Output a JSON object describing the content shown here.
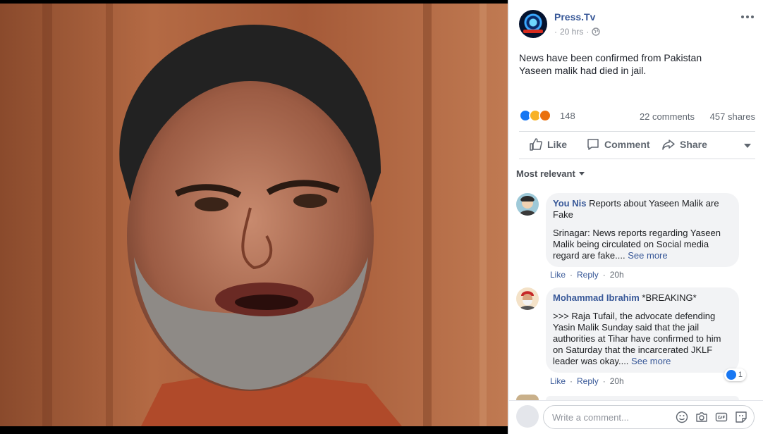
{
  "post": {
    "page_name": "Press.Tv",
    "time": "20 hrs",
    "text_lines": [
      "News have been confirmed from Pakistan",
      "Yaseen malik had died in jail."
    ],
    "reaction_count": "148",
    "comments_count": "22 comments",
    "shares_count": "457 shares"
  },
  "actions": {
    "like": "Like",
    "comment": "Comment",
    "share": "Share"
  },
  "sort_label": "Most relevant",
  "comments": [
    {
      "author": "You Nis",
      "lead": "Reports about Yaseen Malik are Fake",
      "body": "Srinagar: News reports regarding Yaseen Malik being circulated on Social media regard are fake....",
      "see_more": "See more",
      "like": "Like",
      "reply": "Reply",
      "time": "20h"
    },
    {
      "author": "Mohammad Ibrahim",
      "lead": "*BREAKING*",
      "body": ">>> Raja Tufail, the advocate defending Yasin Malik Sunday said that the jail authorities at Tihar have confirmed to him on Saturday that the incarcerated JKLF leader was okay....",
      "see_more": "See more",
      "like": "Like",
      "reply": "Reply",
      "time": "20h",
      "reactions": "1"
    }
  ],
  "composer": {
    "placeholder": "Write a comment..."
  },
  "colors": {
    "link": "#385898",
    "like_blue": "#1877f2",
    "bubble": "#f2f3f5"
  }
}
